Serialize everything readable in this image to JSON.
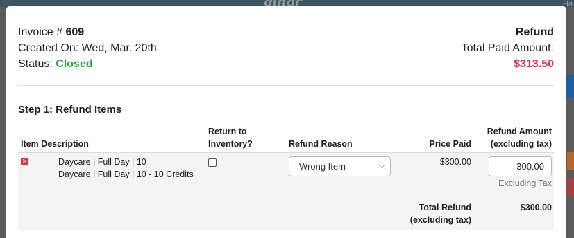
{
  "background": {
    "brand": "gingr",
    "top_right": "Ha"
  },
  "invoice": {
    "label": "Invoice #",
    "number": "609",
    "created_label": "Created On:",
    "created_value": "Wed, Mar. 20th",
    "status_label": "Status:",
    "status_value": "Closed"
  },
  "refund": {
    "title": "Refund",
    "total_paid_label": "Total Paid Amount:",
    "total_paid_value": "$313.50"
  },
  "step1": {
    "title": "Step 1: Refund Items",
    "columns": {
      "item_description": "Item Description",
      "return_line1": "Return to",
      "return_line2": "Inventory?",
      "refund_reason": "Refund Reason",
      "price_paid": "Price Paid",
      "refund_amount_line1": "Refund Amount",
      "refund_amount_line2": "(excluding tax)"
    },
    "rows": [
      {
        "desc_line1": "Daycare | Full Day | 10",
        "desc_line2": "Daycare | Full Day | 10 - 10 Credits",
        "return_to_inventory": false,
        "refund_reason": "Wrong Item",
        "price_paid": "$300.00",
        "refund_amount": "300.00",
        "tax_note": "Excluding Tax"
      }
    ],
    "total": {
      "label_line1": "Total Refund",
      "label_line2": "(excluding tax)",
      "value": "$300.00"
    }
  },
  "colors": {
    "closed_status": "#28a745",
    "paid_amount": "#dc3545",
    "delete_icon": "#dc3545"
  }
}
